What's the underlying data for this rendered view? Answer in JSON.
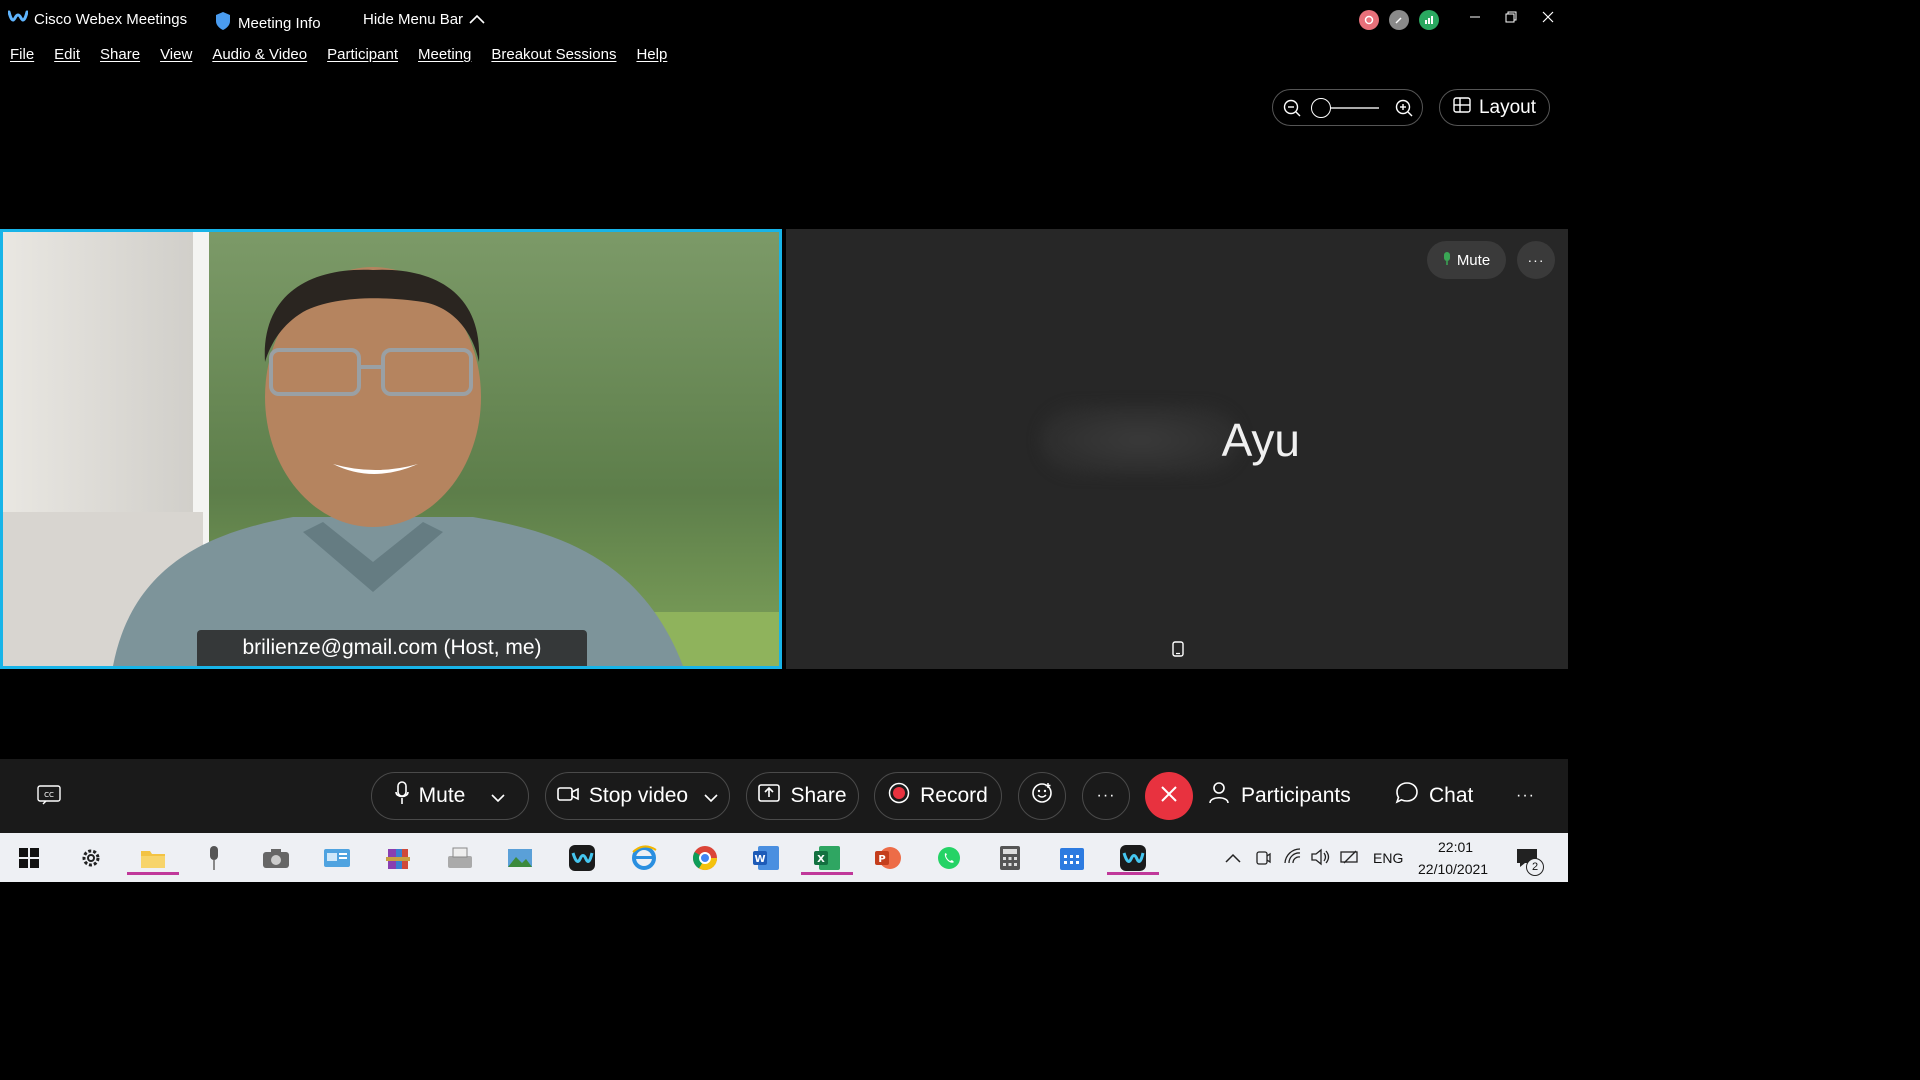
{
  "app": {
    "title": "Cisco Webex Meetings"
  },
  "titlebar": {
    "meeting_info": "Meeting Info",
    "hide_menu_bar": "Hide Menu Bar"
  },
  "menu": [
    "File",
    "Edit",
    "Share",
    "View",
    "Audio & Video",
    "Participant",
    "Meeting",
    "Breakout Sessions",
    "Help"
  ],
  "view": {
    "layout_label": "Layout"
  },
  "videos": {
    "self_label": "brilienze@gmail.com (Host, me)",
    "remote_name": "Ayu",
    "remote_mute_label": "Mute"
  },
  "controls": {
    "mute": "Mute",
    "stop_video": "Stop video",
    "share": "Share",
    "record": "Record",
    "participants": "Participants",
    "chat": "Chat"
  },
  "taskbar": {
    "language": "ENG",
    "time": "22:01",
    "date": "22/10/2021",
    "notifications": "2"
  },
  "colors": {
    "accent": "#18b4e8",
    "end_call": "#e8323f",
    "record": "#e8323f"
  }
}
